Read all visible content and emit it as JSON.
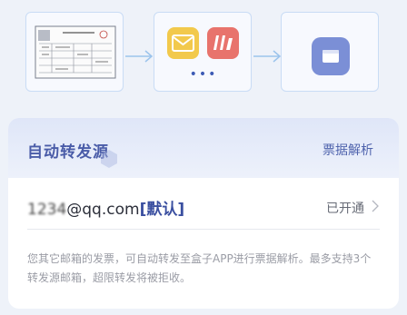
{
  "flow": {
    "step1": {
      "icon": "invoice-document-icon"
    },
    "step2": {
      "icons": [
        "mail-icon",
        "brand-logo-icon"
      ],
      "more": "•••"
    },
    "step3": {
      "icon": "inbox-box-icon"
    }
  },
  "card": {
    "title": "自动转发源",
    "action": "票据解析",
    "email": {
      "prefix_obscured": "1234",
      "address": "@qq.com",
      "tag": "[默认]"
    },
    "status": "已开通",
    "description": "您其它邮箱的发票，可自动转发至盒子APP进行票据解析。最多支持3个转发源邮箱，超限转发将被拒收。"
  },
  "colors": {
    "accent": "#4a5ca8",
    "mail_icon_bg": "#f2c94c",
    "brand_icon_bg": "#e8736c",
    "box_icon_bg": "#7b8fd6"
  }
}
